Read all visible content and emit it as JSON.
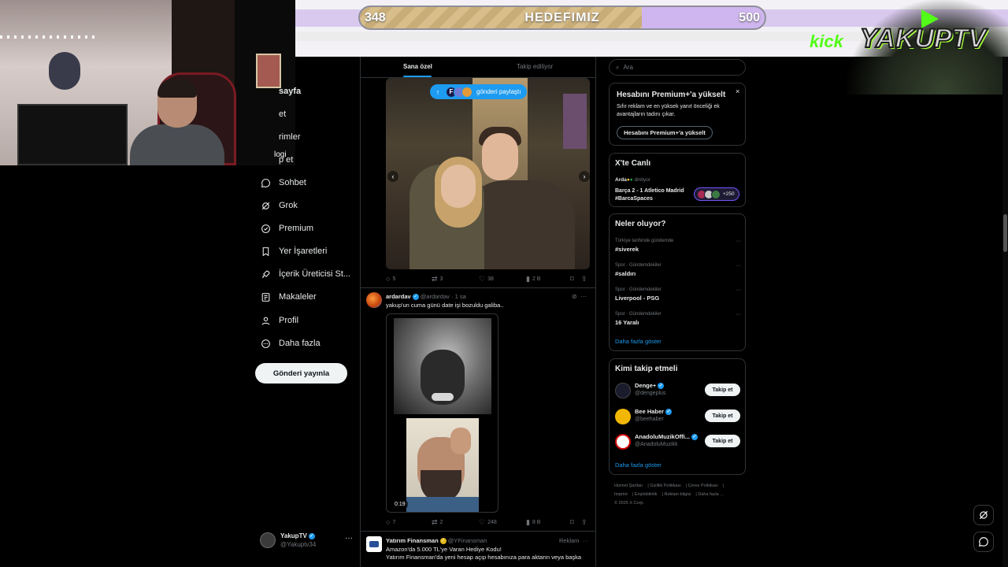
{
  "overlay": {
    "goal_current": "348",
    "goal_label": "HEDEFIMIZ",
    "goal_target": "500",
    "goal_progress": 0.696,
    "kick_label": "kick",
    "channel_logo": "YAKUPTV"
  },
  "webcam": {
    "tag": "logi"
  },
  "nav": {
    "items": [
      {
        "label": "sayfa",
        "icon": "home-icon"
      },
      {
        "label": "et",
        "icon": "explore-icon"
      },
      {
        "label": "rimler",
        "icon": "notifications-icon"
      },
      {
        "label": "p et",
        "icon": "follow-icon"
      },
      {
        "label": "Sohbet",
        "icon": "chat-icon"
      },
      {
        "label": "Grok",
        "icon": "grok-icon"
      },
      {
        "label": "Premium",
        "icon": "premium-icon"
      },
      {
        "label": "Yer İşaretleri",
        "icon": "bookmark-icon"
      },
      {
        "label": "İçerik Üreticisi St...",
        "icon": "rocket-icon"
      },
      {
        "label": "Makaleler",
        "icon": "article-icon"
      },
      {
        "label": "Profil",
        "icon": "profile-icon"
      },
      {
        "label": "Daha fazla",
        "icon": "more-circle-icon"
      }
    ],
    "post_button": "Gönderi yayınla",
    "account": {
      "name": "YakupTV",
      "handle": "@Yakuptv34",
      "more": "···"
    }
  },
  "feed": {
    "tabs": [
      {
        "label": "Sana özel",
        "active": true
      },
      {
        "label": "Takip ediliyor",
        "active": false
      }
    ],
    "share_pill": {
      "letter": "F",
      "label": "gönderi paylaştı"
    },
    "post1": {
      "actions": {
        "replies": "5",
        "reposts": "3",
        "likes": "38",
        "views": "2 B"
      }
    },
    "post2": {
      "name": "ardardav",
      "handle": "@ardardav",
      "time": "· 1 sa",
      "text": "yakup'un cuma günü date işi bozuldu galiba..",
      "duration": "0:19",
      "actions": {
        "replies": "7",
        "reposts": "2",
        "likes": "248",
        "views": "8 B"
      }
    },
    "post3": {
      "name": "Yatırım Finansman",
      "handle": "@YFinansman",
      "ad_label": "Reklam",
      "line1": "Amazon'da 5.000 TL'ye Varan Hediye Kodu!",
      "line2": "Yatırım Finansman'da yeni hesap açıp hesabınıza para aktarın veya başka"
    }
  },
  "right": {
    "search_placeholder": "Ara",
    "premium": {
      "title": "Hesabını Premium+'a yükselt",
      "close": "×",
      "desc": "Sıfır reklam ve en yüksek yanıt önceliği ek avantajların tadını çıkar.",
      "button": "Hesabını Premium+'a yükselt"
    },
    "live": {
      "title": "X'te Canlı",
      "user": "Arda",
      "status": "dinliyor",
      "space": "Barça 2 - 1 Atletico Madrid #BarcaSpaces",
      "count": "+250"
    },
    "trends": {
      "title": "Neler oluyor?",
      "items": [
        {
          "context": "Türkiye tarihinde gündemde",
          "name": "#siverek"
        },
        {
          "context": "Spor · Gündemdekiler",
          "name": "#saldırı"
        },
        {
          "context": "Spor · Gündemdekiler",
          "name": "Liverpool - PSG"
        },
        {
          "context": "Spor · Gündemdekiler",
          "name": "16 Yaralı"
        }
      ],
      "more": "Daha fazla göster"
    },
    "follow": {
      "title": "Kimi takip etmeli",
      "items": [
        {
          "name": "Denge+",
          "handle": "@dengeplus",
          "button": "Takip et",
          "color": "#1b1b2e"
        },
        {
          "name": "Bee Haber",
          "handle": "@beehaber",
          "button": "Takip et",
          "color": "#f2b705"
        },
        {
          "name": "AnadoluMuzikOffi...",
          "handle": "@AnadoluMuzikk",
          "button": "Takip et",
          "color": "#ffffff"
        }
      ],
      "more": "Daha fazla göster"
    },
    "footer": {
      "l1": [
        "Hizmet Şartları",
        "Gizlilik Politikası",
        "Çerez Politikası"
      ],
      "l2": [
        "Imprint",
        "Erişilebilirlik",
        "Reklam bilgisi",
        "Daha fazla ..."
      ],
      "l3": "© 2025 X Corp."
    }
  }
}
